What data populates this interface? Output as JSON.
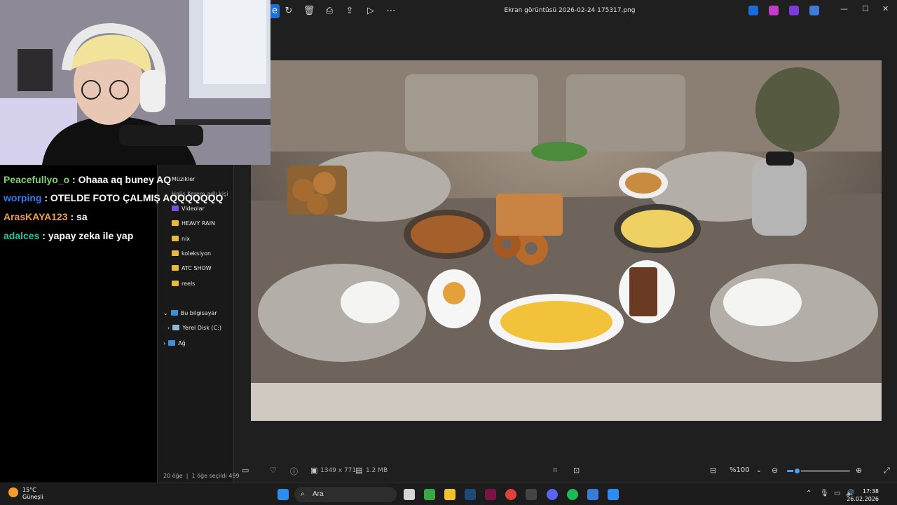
{
  "viewer": {
    "title": "Ekran görüntüsü 2026-02-24 175317.png",
    "zoom_value": "%100",
    "zoom_level_fraction": 0.15,
    "dimensions": "1349 x 771",
    "file_size": "1.2 MB",
    "icons": [
      "edit-icon",
      "rotate-icon",
      "delete-icon",
      "print-icon",
      "share-icon",
      "slideshow-icon",
      "more-icon"
    ]
  },
  "explorer": {
    "partial_item": "Müzikler",
    "partial_item2": "Halis Kerem adlı kişi",
    "items": [
      "Videolar",
      "HEAVY RAIN",
      "nix",
      "koleksiyon",
      "ATC SHOW",
      "reels"
    ],
    "this_pc": "Bu bilgisayar",
    "drive": "Yerel Disk (C:)",
    "network": "Ağ",
    "status_count": "20 öğe",
    "status_selected": "1 öğe seçildi  499"
  },
  "chat": {
    "messages": [
      {
        "user": "Peacefullyo_o",
        "user_color": "#7fd36b",
        "text": "Ohaaa aq buney AQ"
      },
      {
        "user": "worping",
        "user_color": "#2f7df6",
        "text": "OTELDE FOTO ÇALMIŞ AQQQQQQQ"
      },
      {
        "user": "ArasKAYA123",
        "user_color": "#f0a13c",
        "text": "sa"
      },
      {
        "user": "adalces",
        "user_color": "#28c2a0",
        "text": "yapay zeka ile yap"
      }
    ]
  },
  "taskbar": {
    "temp": "15°C",
    "weather": "Güneşli",
    "search": "Ara",
    "time": "17:38",
    "date": "26.02.2026"
  }
}
